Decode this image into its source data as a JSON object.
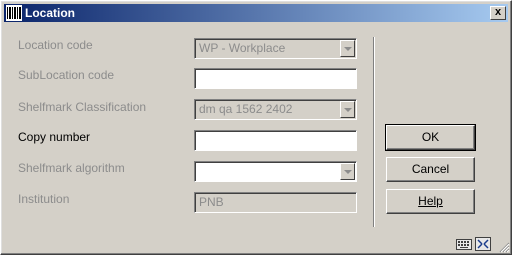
{
  "window": {
    "title": "Location",
    "close_label": "x"
  },
  "form": {
    "location_code": {
      "label": "Location code",
      "value": "WP - Workplace"
    },
    "sublocation_code": {
      "label": "SubLocation code",
      "value": ""
    },
    "shelfmark_classification": {
      "label": "Shelfmark Classification",
      "value": "dm qa 1562 2402"
    },
    "copy_number": {
      "label": "Copy number",
      "value": ""
    },
    "shelfmark_algorithm": {
      "label": "Shelfmark algorithm",
      "value": ""
    },
    "institution": {
      "label": "Institution",
      "value": "PNB"
    }
  },
  "buttons": {
    "ok": "OK",
    "cancel": "Cancel",
    "help": "Help"
  },
  "icons": [
    "barcode-icon",
    "keyboard-icon",
    "resize-icon",
    "size-grip-icon"
  ]
}
